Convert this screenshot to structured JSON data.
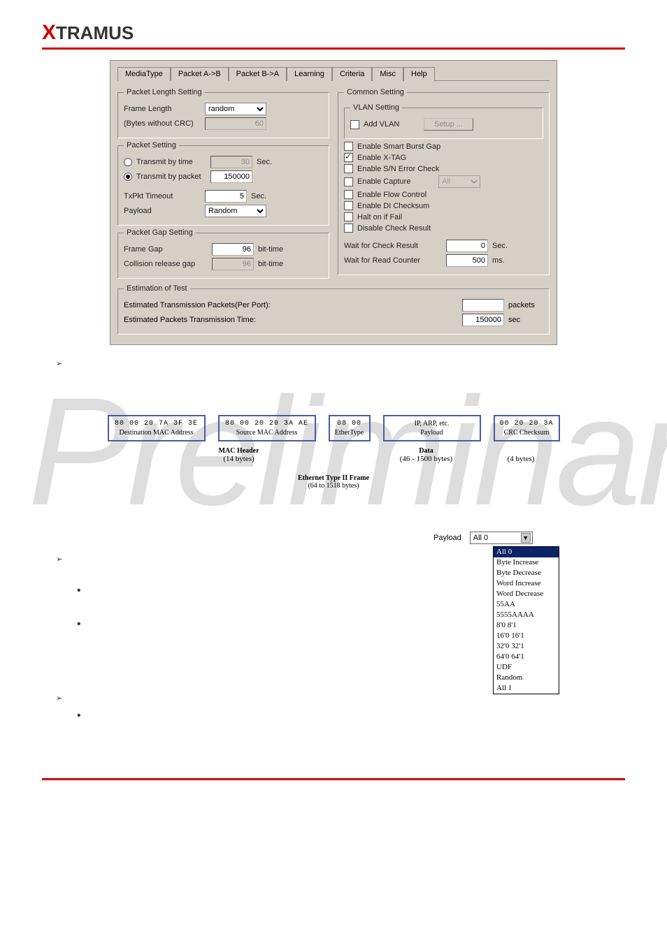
{
  "logo": {
    "x": "X",
    "rest": "TRAMUS"
  },
  "tabs": [
    "MediaType",
    "Packet A->B",
    "Packet B->A",
    "Learning",
    "Criteria",
    "Misc",
    "Help"
  ],
  "active_tab": "Packet A->B",
  "packet_length": {
    "legend": "Packet Length Setting",
    "frame_length_label": "Frame Length",
    "frame_length_value": "random",
    "bytes_note": "(Bytes without CRC)",
    "bytes_value": "60"
  },
  "packet_setting": {
    "legend": "Packet Setting",
    "by_time_label": "Transmit by time",
    "by_time_value": "30",
    "by_time_unit": "Sec.",
    "by_packet_label": "Transmit by packet",
    "by_packet_value": "150000",
    "txpkt_timeout_label": "TxPkt Timeout",
    "txpkt_timeout_value": "5",
    "txpkt_timeout_unit": "Sec.",
    "payload_label": "Payload",
    "payload_value": "Random"
  },
  "packet_gap": {
    "legend": "Packet Gap Setting",
    "frame_gap_label": "Frame Gap",
    "frame_gap_value": "96",
    "frame_gap_unit": "bit-time",
    "collision_label": "Collision release gap",
    "collision_value": "96",
    "collision_unit": "bit-time"
  },
  "common": {
    "legend": "Common Setting",
    "vlan_legend": "VLAN Setting",
    "add_vlan_label": "Add VLAN",
    "setup_btn": "Setup ...",
    "opts": {
      "smart_burst": "Enable Smart Burst Gap",
      "xtag": "Enable X-TAG",
      "sn_err": "Enable S/N Error Check",
      "capture": "Enable Capture",
      "capture_sel": "All",
      "flow": "Enable Flow Control",
      "di_chk": "Enable DI Checksum",
      "halt": "Halt on if Fail",
      "disable_chk": "Disable Check Result"
    },
    "wait_check_label": "Wait for Check Result",
    "wait_check_value": "0",
    "wait_check_unit": "Sec.",
    "wait_read_label": "Wait for Read Counter",
    "wait_read_value": "500",
    "wait_read_unit": "ms."
  },
  "estimation": {
    "legend": "Estimation of Test",
    "row1_label": "Estimated Transmission Packets(Per Port):",
    "row1_value": "",
    "row1_unit": "packets",
    "row2_label": "Estimated Packets Transmission Time:",
    "row2_value": "150000",
    "row2_unit": "sec"
  },
  "frame": {
    "dest_hex": "80 00 20 7A 3F 3E",
    "dest_label": "Destination MAC Address",
    "src_hex": "80 00 20 20 3A AE",
    "src_label": "Source MAC Address",
    "etype_hex": "08 00",
    "etype_label": "EtherType",
    "payload_top": "IP, ARP, etc.",
    "payload_bottom": "Payload",
    "crc_hex": "00 20 20 3A",
    "crc_label": "CRC Checksum",
    "mac_header": "MAC Header",
    "mac_bytes": "(14 bytes)",
    "data_label": "Data",
    "data_bytes": "(46 - 1500 bytes)",
    "crc_bytes": "(4 bytes)",
    "frame_title": "Ethernet Type II Frame",
    "frame_bytes": "(64 to 1518 bytes)"
  },
  "payload_fig": {
    "label": "Payload",
    "selected": "All 0",
    "options": [
      "All 0",
      "Byte Increase",
      "Byte Decrease",
      "Word Increase",
      "Word Decrease",
      "55AA",
      "5555AAAA",
      "8'0 8'1",
      "16'0 16'1",
      "32'0 32'1",
      "64'0 64'1",
      "UDF",
      "Random",
      "All 1"
    ]
  },
  "watermark": "Preliminary"
}
